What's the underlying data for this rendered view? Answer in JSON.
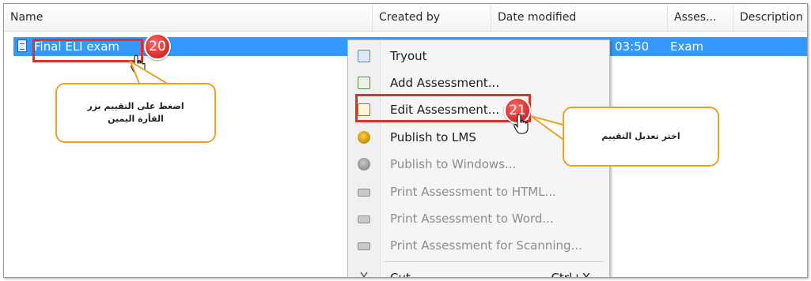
{
  "header": {
    "columns": [
      "Name",
      "Created by",
      "Date modified",
      "Asses...",
      "Description"
    ]
  },
  "row": {
    "name": "Final ELI exam",
    "time": "03:50",
    "assessment_type": "Exam"
  },
  "steps": {
    "step1": "20",
    "step2": "21"
  },
  "callouts": {
    "right_click_hint": "اضغط على التقييم بزر الفأرة اليمين",
    "edit_hint": "اختر تعديل التقييم"
  },
  "context_menu": {
    "items": [
      {
        "label": "Tryout",
        "icon": "tryout-icon",
        "enabled": true
      },
      {
        "label": "Add Assessment...",
        "icon": "add-assessment-icon",
        "enabled": true
      },
      {
        "label": "Edit Assessment...",
        "icon": "edit-assessment-icon",
        "enabled": true
      },
      {
        "label": "Publish to LMS",
        "icon": "publish-lms-icon",
        "enabled": true
      },
      {
        "label": "Publish to Windows...",
        "icon": "publish-windows-icon",
        "enabled": false
      },
      {
        "label": "Print Assessment to HTML...",
        "icon": "print-html-icon",
        "enabled": false
      },
      {
        "label": "Print Assessment to Word...",
        "icon": "print-word-icon",
        "enabled": false
      },
      {
        "label": "Print Assessment for Scanning...",
        "icon": "print-scanning-icon",
        "enabled": false
      },
      {
        "label": "Cut",
        "icon": "cut-icon",
        "enabled": true,
        "shortcut": "Ctrl+X"
      }
    ]
  },
  "colors": {
    "selection": "#3399ff",
    "highlight_border": "#e0302c",
    "callout_border": "#f0a020",
    "badge": "#d22a26"
  }
}
